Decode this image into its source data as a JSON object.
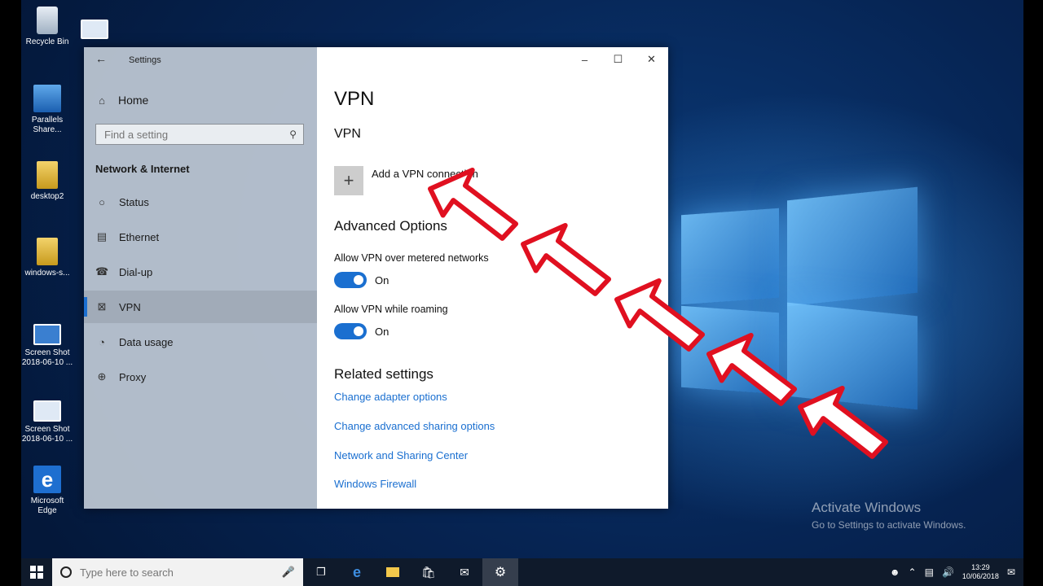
{
  "desktop": {
    "icons": [
      {
        "label": "Recycle Bin"
      },
      {
        "label": "Parallels Share..."
      },
      {
        "label": "desktop2"
      },
      {
        "label": "windows-s..."
      },
      {
        "label": "Screen Shot 2018-06-10 ..."
      },
      {
        "label": "Screen Shot 2018-06-10 ..."
      },
      {
        "label": "Microsoft Edge"
      }
    ],
    "activate_title": "Activate Windows",
    "activate_sub": "Go to Settings to activate Windows."
  },
  "settings": {
    "window_title": "Settings",
    "home_label": "Home",
    "search_placeholder": "Find a setting",
    "section": "Network & Internet",
    "nav": [
      {
        "label": "Status",
        "icon": "globe-icon"
      },
      {
        "label": "Ethernet",
        "icon": "ethernet-icon"
      },
      {
        "label": "Dial-up",
        "icon": "phone-icon"
      },
      {
        "label": "VPN",
        "icon": "vpn-icon"
      },
      {
        "label": "Data usage",
        "icon": "data-usage-icon"
      },
      {
        "label": "Proxy",
        "icon": "proxy-icon"
      }
    ],
    "page_title": "VPN",
    "subheading": "VPN",
    "add_vpn_label": "Add a VPN connection",
    "advanced_heading": "Advanced Options",
    "options": [
      {
        "label": "Allow VPN over metered networks",
        "state": "On"
      },
      {
        "label": "Allow VPN while roaming",
        "state": "On"
      }
    ],
    "related_heading": "Related settings",
    "links": [
      "Change adapter options",
      "Change advanced sharing options",
      "Network and Sharing Center",
      "Windows Firewall"
    ]
  },
  "taskbar": {
    "search_placeholder": "Type here to search",
    "time": "13:29",
    "date": "10/06/2018"
  },
  "colors": {
    "accent": "#1a6fd0",
    "arrow": "#e01020"
  }
}
